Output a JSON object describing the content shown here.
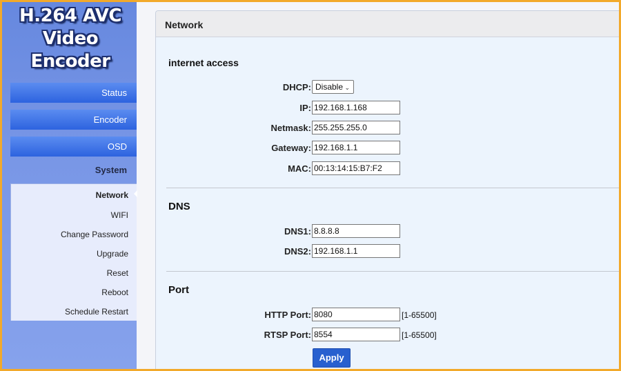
{
  "app": {
    "logo_line1": "H.264 AVC",
    "logo_line2": "Video Encoder"
  },
  "sidebar": {
    "status_label": "Status",
    "encoder_label": "Encoder",
    "osd_label": "OSD",
    "system_title": "System",
    "system_items": [
      {
        "label": "Network",
        "active": true
      },
      {
        "label": "WIFI"
      },
      {
        "label": "Change Password"
      },
      {
        "label": "Upgrade"
      },
      {
        "label": "Reset"
      },
      {
        "label": "Reboot"
      },
      {
        "label": "Schedule Restart"
      }
    ]
  },
  "panel": {
    "title": "Network",
    "internet_access": {
      "heading": "internet access",
      "dhcp_label": "DHCP:",
      "dhcp_value": "Disable",
      "ip_label": "IP:",
      "ip_value": "192.168.1.168",
      "netmask_label": "Netmask:",
      "netmask_value": "255.255.255.0",
      "gateway_label": "Gateway:",
      "gateway_value": "192.168.1.1",
      "mac_label": "MAC:",
      "mac_value": "00:13:14:15:B7:F2"
    },
    "dns": {
      "heading": "DNS",
      "dns1_label": "DNS1:",
      "dns1_value": "8.8.8.8",
      "dns2_label": "DNS2:",
      "dns2_value": "192.168.1.1"
    },
    "port": {
      "heading": "Port",
      "http_label": "HTTP Port:",
      "http_value": "8080",
      "http_range": "[1-65500]",
      "rtsp_label": "RTSP Port:",
      "rtsp_value": "8554",
      "rtsp_range": "[1-65500]"
    },
    "apply_label": "Apply"
  },
  "colors": {
    "frame_border": "#f2a92b",
    "nav_button": "#2d63df",
    "apply_button": "#2860cf",
    "panel_bg": "#ecf4fd"
  }
}
